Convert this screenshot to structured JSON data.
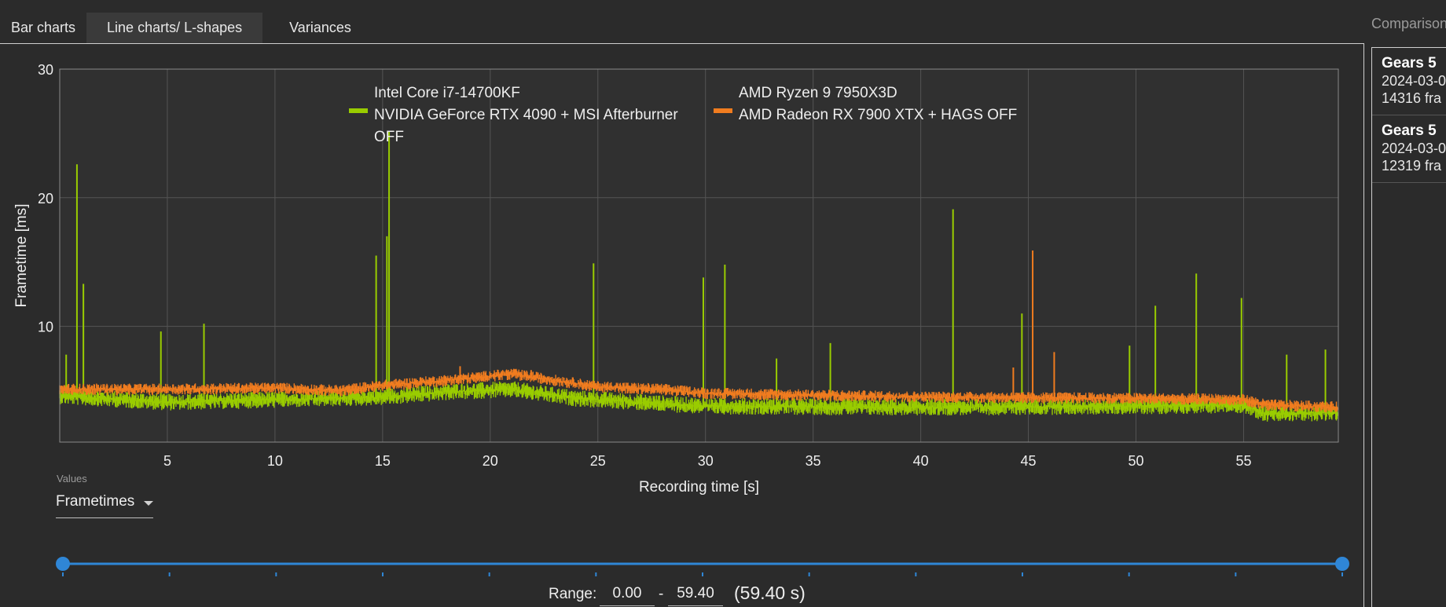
{
  "tabs": [
    {
      "label": "Bar charts",
      "active": false
    },
    {
      "label": "Line charts/ L-shapes",
      "active": true
    },
    {
      "label": "Variances",
      "active": false
    }
  ],
  "comparison": {
    "title": "Comparison",
    "items": [
      {
        "game": "Gears 5",
        "date": "2024-03-0",
        "frames": "14316 fra"
      },
      {
        "game": "Gears 5",
        "date": "2024-03-0",
        "frames": "12319 fra"
      }
    ]
  },
  "chart_data": {
    "type": "line",
    "xlabel": "Recording time [s]",
    "ylabel": "Frametime [ms]",
    "xlim": [
      0,
      59.4
    ],
    "ylim": [
      1,
      30
    ],
    "x_ticks": [
      5,
      10,
      15,
      20,
      25,
      30,
      35,
      40,
      45,
      50,
      55
    ],
    "y_ticks": [
      10,
      20,
      30
    ],
    "grid": true,
    "legend_position": "top-center",
    "series": [
      {
        "name": "Intel Core i7-14700KF NVIDIA GeForce RTX 4090 + MSI Afterburner OFF",
        "legend_lines": [
          "Intel Core i7-14700KF",
          "NVIDIA GeForce RTX 4090 + MSI Afterburner",
          "OFF"
        ],
        "color": "#99cc00",
        "baseline": [
          [
            0,
            4.6
          ],
          [
            5,
            4.1
          ],
          [
            10,
            4.3
          ],
          [
            15,
            4.5
          ],
          [
            18,
            4.9
          ],
          [
            21,
            5.1
          ],
          [
            24,
            4.4
          ],
          [
            28,
            4.0
          ],
          [
            30,
            3.8
          ],
          [
            40,
            3.7
          ],
          [
            50,
            3.8
          ],
          [
            55,
            3.9
          ],
          [
            56,
            3.2
          ],
          [
            59.4,
            3.3
          ]
        ],
        "spikes": [
          [
            0.3,
            7.8
          ],
          [
            0.8,
            22.6
          ],
          [
            1.1,
            13.3
          ],
          [
            4.7,
            9.6
          ],
          [
            6.7,
            10.2
          ],
          [
            14.7,
            15.5
          ],
          [
            15.2,
            17.0
          ],
          [
            15.3,
            25.2
          ],
          [
            24.8,
            14.9
          ],
          [
            29.9,
            13.8
          ],
          [
            30.9,
            14.8
          ],
          [
            33.3,
            7.5
          ],
          [
            35.8,
            8.7
          ],
          [
            41.5,
            19.1
          ],
          [
            44.7,
            11.0
          ],
          [
            49.7,
            8.5
          ],
          [
            50.9,
            11.6
          ],
          [
            52.8,
            14.1
          ],
          [
            54.9,
            12.2
          ],
          [
            57.0,
            7.8
          ],
          [
            58.8,
            8.2
          ]
        ]
      },
      {
        "name": "AMD Ryzen 9 7950X3D AMD Radeon RX 7900 XTX + HAGS OFF",
        "legend_lines": [
          "AMD Ryzen 9 7950X3D",
          "AMD Radeon RX 7900 XTX + HAGS OFF"
        ],
        "color": "#f07c1f",
        "baseline": [
          [
            0,
            5.1
          ],
          [
            5,
            5.1
          ],
          [
            10,
            5.2
          ],
          [
            13,
            5.0
          ],
          [
            15,
            5.4
          ],
          [
            18,
            5.8
          ],
          [
            21,
            6.3
          ],
          [
            23,
            5.8
          ],
          [
            25,
            5.3
          ],
          [
            28,
            5.1
          ],
          [
            30,
            4.8
          ],
          [
            40,
            4.5
          ],
          [
            50,
            4.4
          ],
          [
            55,
            4.3
          ],
          [
            56,
            3.9
          ],
          [
            59.4,
            3.7
          ]
        ],
        "spikes": [
          [
            18.6,
            6.9
          ],
          [
            21.9,
            6.6
          ],
          [
            45.2,
            15.9
          ],
          [
            46.2,
            8.0
          ],
          [
            44.3,
            6.8
          ]
        ]
      }
    ]
  },
  "values_dropdown": {
    "label": "Values",
    "selected": "Frametimes"
  },
  "range": {
    "label": "Range:",
    "start": "0.00",
    "separator": "-",
    "end": "59.40",
    "duration": "(59.40 s)",
    "slider_low": 0.0,
    "slider_high": 59.4
  }
}
